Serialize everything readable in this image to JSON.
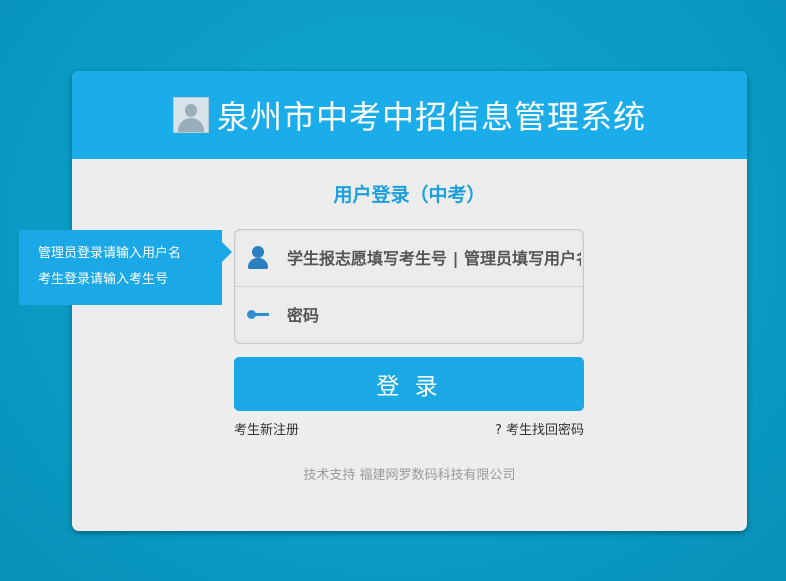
{
  "header": {
    "title": "泉州市中考中招信息管理系统",
    "logo_icon": "user-avatar-icon"
  },
  "login": {
    "heading": "用户登录（中考）",
    "username_placeholder": "学生报志愿填写考生号 | 管理员填写用户名",
    "password_placeholder": "密码",
    "username_icon": "user-icon",
    "password_icon": "key-icon",
    "submit_label": "登 录"
  },
  "links": {
    "register": "考生新注册",
    "forgot_password": "? 考生找回密码"
  },
  "footer": {
    "text": "技术支持 福建网罗数码科技有限公司"
  },
  "tooltip": {
    "line1": "管理员登录请输入用户名",
    "line2": "考生登录请输入考生号"
  },
  "colors": {
    "background": "#0b9fc7",
    "accent": "#1badea",
    "card": "#ededed",
    "heading": "#1b9fdc"
  }
}
